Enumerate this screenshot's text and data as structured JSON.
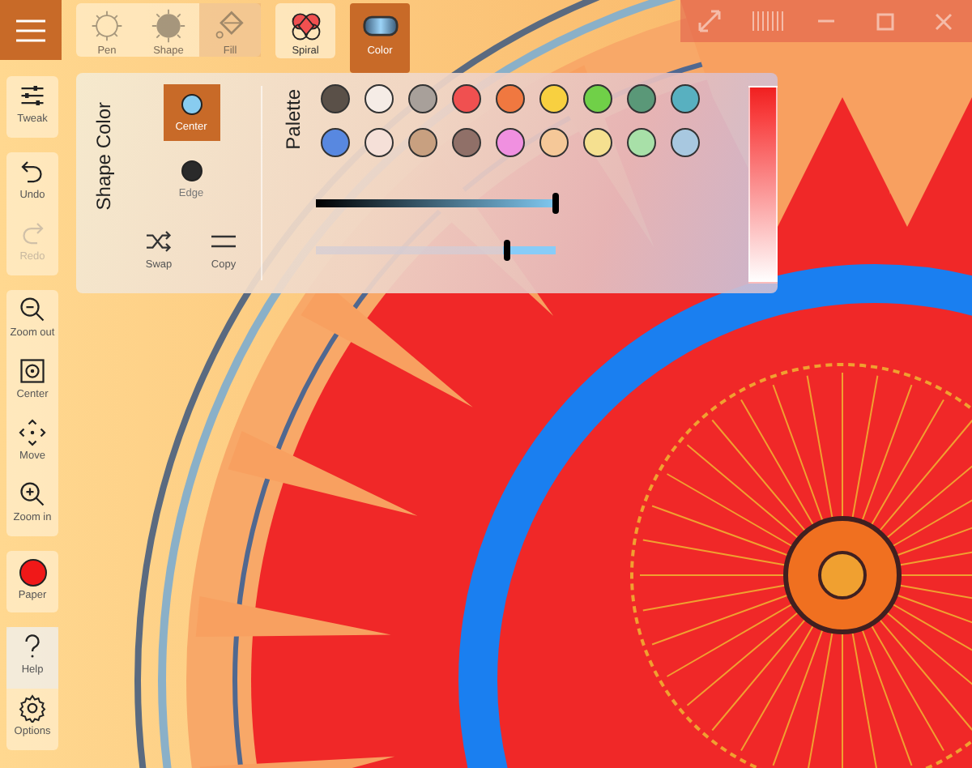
{
  "toolbar": {
    "tools": [
      {
        "label": "Pen",
        "kind": "pen",
        "selected": false,
        "disabled": true
      },
      {
        "label": "Shape",
        "kind": "shape",
        "selected": false,
        "disabled": true
      },
      {
        "label": "Fill",
        "kind": "fill",
        "selected": true,
        "disabled": true
      }
    ],
    "modes": [
      {
        "label": "Spiral",
        "kind": "spiral",
        "selected": false
      },
      {
        "label": "Color",
        "kind": "color",
        "selected": true
      }
    ]
  },
  "sidebar": {
    "groups": [
      {
        "items": [
          {
            "label": "Tweak",
            "kind": "tweak",
            "disabled": false
          }
        ]
      },
      {
        "items": [
          {
            "label": "Undo",
            "kind": "undo",
            "disabled": false
          },
          {
            "label": "Redo",
            "kind": "redo",
            "disabled": true
          }
        ]
      },
      {
        "items": [
          {
            "label": "Zoom out",
            "kind": "zoom-out",
            "disabled": false
          },
          {
            "label": "Center",
            "kind": "center",
            "disabled": false
          },
          {
            "label": "Move",
            "kind": "move",
            "disabled": false
          },
          {
            "label": "Zoom in",
            "kind": "zoom-in",
            "disabled": false
          }
        ]
      },
      {
        "items": [
          {
            "label": "Paper",
            "kind": "paper",
            "disabled": false,
            "color": "#f01818"
          }
        ]
      },
      {
        "items": [
          {
            "label": "Help",
            "kind": "help",
            "disabled": false
          },
          {
            "label": "Options",
            "kind": "options",
            "disabled": false
          }
        ]
      }
    ]
  },
  "panel": {
    "shape_color": {
      "title": "Shape Color",
      "targets": [
        {
          "label": "Center",
          "selected": true,
          "color": "#88ccf0"
        },
        {
          "label": "Edge",
          "selected": false,
          "color": "#2a2a2a"
        }
      ],
      "actions": [
        {
          "label": "Swap",
          "kind": "swap"
        },
        {
          "label": "Copy",
          "kind": "copy"
        }
      ]
    },
    "palette": {
      "title": "Palette",
      "swatches": [
        {
          "color": "#5a5048"
        },
        {
          "color": "#f5ece6"
        },
        {
          "color": "#a8a09a"
        },
        {
          "color": "#f05050"
        },
        {
          "color": "#f07840"
        },
        {
          "color": "#f8d040"
        },
        {
          "color": "#70d048"
        },
        {
          "color": "#5a9878"
        },
        {
          "color": "#58b0c0"
        },
        {
          "color": "#5888e0"
        },
        {
          "color": "#f5e0d8"
        },
        {
          "color": "#c8a080"
        },
        {
          "color": "#907068"
        },
        {
          "color": "#f090e0"
        },
        {
          "color": "#f5c898"
        },
        {
          "color": "#f5e090"
        },
        {
          "color": "#a8e0a8"
        },
        {
          "color": "#a8c8e0"
        }
      ],
      "color_slider": {
        "level": 1
      },
      "opacity_slider": {
        "level": 0.8
      }
    }
  }
}
